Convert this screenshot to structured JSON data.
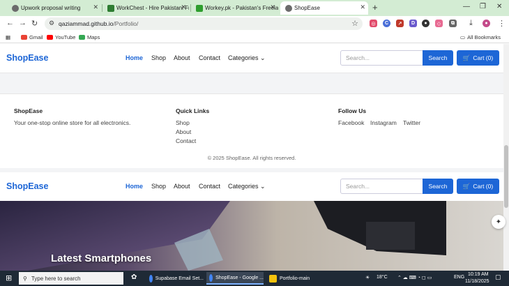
{
  "browser": {
    "tabs": [
      {
        "title": "Upwork proposal writing",
        "favicon_color": "#6b6b6b"
      },
      {
        "title": "WorkChest - Hire Pakistani Free...",
        "favicon_color": "#2e7d32"
      },
      {
        "title": "Workey.pk - Pakistan's Freelanc...",
        "favicon_color": "#2e9e2e"
      },
      {
        "title": "ShopEase",
        "favicon_color": "#6b6b6b"
      }
    ],
    "url_host": "qaziammad.github.io",
    "url_path": "/Portfolio/",
    "bookmarks": [
      "Gmail",
      "YouTube",
      "Maps"
    ],
    "all_bookmarks": "All Bookmarks"
  },
  "site": {
    "brand": "ShopEase",
    "nav": [
      "Home",
      "Shop",
      "About",
      "Contact",
      "Categories"
    ],
    "search_placeholder": "Search...",
    "search_button": "Search",
    "cart_label": "Cart (0)",
    "accent": "#1d66d6"
  },
  "footer": {
    "about_title": "ShopEase",
    "about_text": "Your one-stop online store for all electronics.",
    "links_title": "Quick Links",
    "links": [
      "Shop",
      "About",
      "Contact"
    ],
    "follow_title": "Follow Us",
    "social": [
      "Facebook",
      "Instagram",
      "Twitter"
    ],
    "copyright": "© 2025 ShopEase. All rights reserved."
  },
  "hero": {
    "title": "Latest Smartphones"
  },
  "taskbar": {
    "search_placeholder": "Type here to search",
    "apps": [
      "Supabase Email Set...",
      "ShopEase - Google ...",
      "Portfolio-main"
    ],
    "weather": "18°C",
    "lang": "ENG",
    "time": "10:19 AM",
    "date": "11/18/2025"
  }
}
